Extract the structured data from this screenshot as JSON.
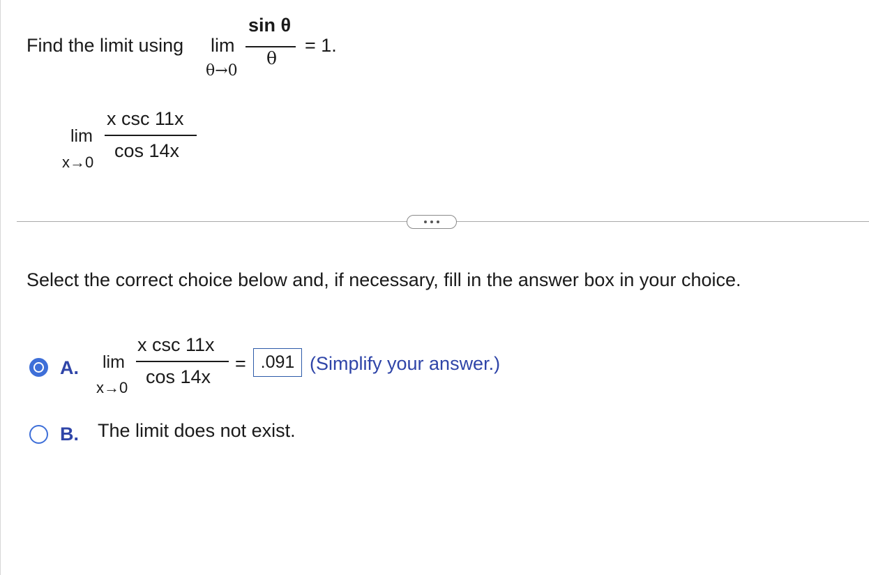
{
  "question": {
    "prefix": "Find the limit using",
    "lim": "lim",
    "lim_sub": "θ→0",
    "numerator": "sin θ",
    "denominator": "θ",
    "suffix": "= 1."
  },
  "problem": {
    "lim": "lim",
    "lim_sub": "x→0",
    "numerator": "x csc 11x",
    "denominator": "cos 14x"
  },
  "instructions": "Select the correct choice below and, if necessary, fill in the answer box in your choice.",
  "choices": [
    {
      "letter": "A.",
      "selected": true,
      "lim": "lim",
      "lim_sub": "x→0",
      "numerator": "x csc 11x",
      "denominator": "cos 14x",
      "equals": "=",
      "answer_value": ".091",
      "hint": "(Simplify your answer.)"
    },
    {
      "letter": "B.",
      "selected": false,
      "text": "The limit does not exist."
    }
  ],
  "colors": {
    "accent": "#3e6fd8",
    "label": "#2f45a8",
    "answer_border": "#2d5aa8",
    "divider": "#a9a9a9"
  },
  "icons": {
    "more": "ellipsis-icon"
  }
}
